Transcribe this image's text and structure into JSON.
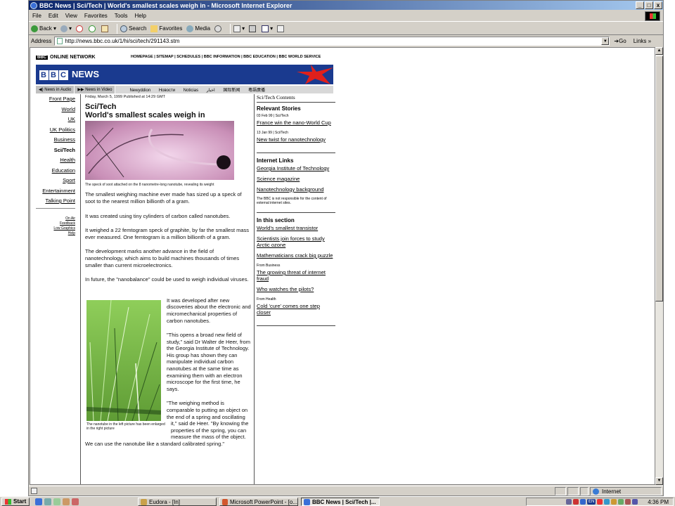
{
  "window": {
    "title": "BBC News | Sci/Tech | World's smallest scales weigh in - Microsoft Internet Explorer",
    "controls": [
      "_",
      "□",
      "x"
    ]
  },
  "menu": [
    "File",
    "Edit",
    "View",
    "Favorites",
    "Tools",
    "Help"
  ],
  "toolbar": {
    "back": "Back",
    "search": "Search",
    "favorites": "Favorites",
    "media": "Media"
  },
  "address": {
    "label": "Address",
    "url": "http://news.bbc.co.uk/1/hi/sci/tech/291143.stm",
    "go": "Go",
    "links": "Links"
  },
  "page": {
    "network": "ONLINE NETWORK",
    "network_badge": "BBC",
    "topnav": "HOMEPAGE | SITEMAP | SCHEDULES | BBC INFORMATION | BBC EDUCATION | BBC WORLD SERVICE",
    "logo_letters": [
      "B",
      "B",
      "C"
    ],
    "logo_news": "NEWS",
    "subbar": {
      "audio": "News in Audio",
      "video": "News in Video",
      "langs": [
        "Newyddion",
        "Новости",
        "Noticias",
        "اخبار",
        "国际新闻",
        "粵語廣播"
      ]
    },
    "leftnav": [
      "Front Page",
      "World",
      "UK",
      "UK Politics",
      "Business",
      "Sci/Tech",
      "Health",
      "Education",
      "Sport",
      "Entertainment",
      "Talking Point"
    ],
    "leftnav_active": "Sci/Tech",
    "smalllinks": [
      "On Air",
      "Feedback",
      "Low Graphics",
      "Help"
    ],
    "article": {
      "dateline": "Friday, March 5, 1999 Published at 14:29 GMT",
      "section": "Sci/Tech",
      "headline": "World's smallest scales weigh in",
      "image_caption": "The speck of soot attached on the 8 nanometre-long nanotube, revealing its weight",
      "paragraphs": [
        "The smallest weighing machine ever made has sized up a speck of soot to the nearest million billionth of a gram.",
        "It was created using tiny cylinders of carbon called nanotubes.",
        "It weighed a 22 femtogram speck of graphite, by far the smallest mass ever measured. One femtogram is a million billionth of a gram.",
        "The development marks another advance in the field of nanotechnology, which aims to build machines thousands of times smaller than current microelectronics.",
        "In future, the \"nanobalance\" could be used to weigh individual viruses."
      ],
      "image2_caption": "The nanotube in the left picture has been enlarged in the right picture",
      "paragraphs2": [
        "It was developed after new discoveries about the electronic and micromechanical properties of carbon nanotubes.",
        "\"This opens a broad new field of study,\" said Dr Walter de Heer, from the Georgia Institute of Technology. His group has shown they can manipulate individual carbon nanotubes at the same time as examining them with an electron microscope for the first time, he says.",
        "\"The weighing method is comparable to putting an object on the end of a spring and oscillating it,\" said de Heer. \"By knowing the properties of the spring, you can measure the mass of the object. We can use the nanotube like a standard calibrated spring.\""
      ]
    },
    "right": {
      "contents": "Sci/Tech Contents",
      "relevant_title": "Relevant Stories",
      "relevant": [
        {
          "meta": "03 Feb 99 | Sci/Tech",
          "title": "France win the nano-World Cup"
        },
        {
          "meta": "13 Jan 99 | Sci/Tech",
          "title": "New twist for nanotechnology"
        }
      ],
      "internet_title": "Internet Links",
      "internet": [
        "Georgia Institute of Technology",
        "Science magazine",
        "Nanotechnology background"
      ],
      "disclaimer": "The BBC is not responsible for the content of external internet sites.",
      "section_title": "In this section",
      "section_links": [
        {
          "meta": "",
          "title": "World's smallest transistor"
        },
        {
          "meta": "",
          "title": "Scientists join forces to study Arctic ozone"
        },
        {
          "meta": "",
          "title": "Mathematicians crack big puzzle"
        },
        {
          "meta": "From Business",
          "title": "The growing threat of internet fraud"
        },
        {
          "meta": "",
          "title": "Who watches the pilots?"
        },
        {
          "meta": "From Health",
          "title": "Cold 'cure' comes one step closer"
        }
      ]
    }
  },
  "status": {
    "zone": "Internet"
  },
  "taskbar": {
    "start": "Start",
    "tasks": [
      "Eudora - [In]",
      "Microsoft PowerPoint - [o...",
      "BBC News | Sci/Tech |..."
    ],
    "lang": "EN",
    "clock": "4:36 PM"
  }
}
